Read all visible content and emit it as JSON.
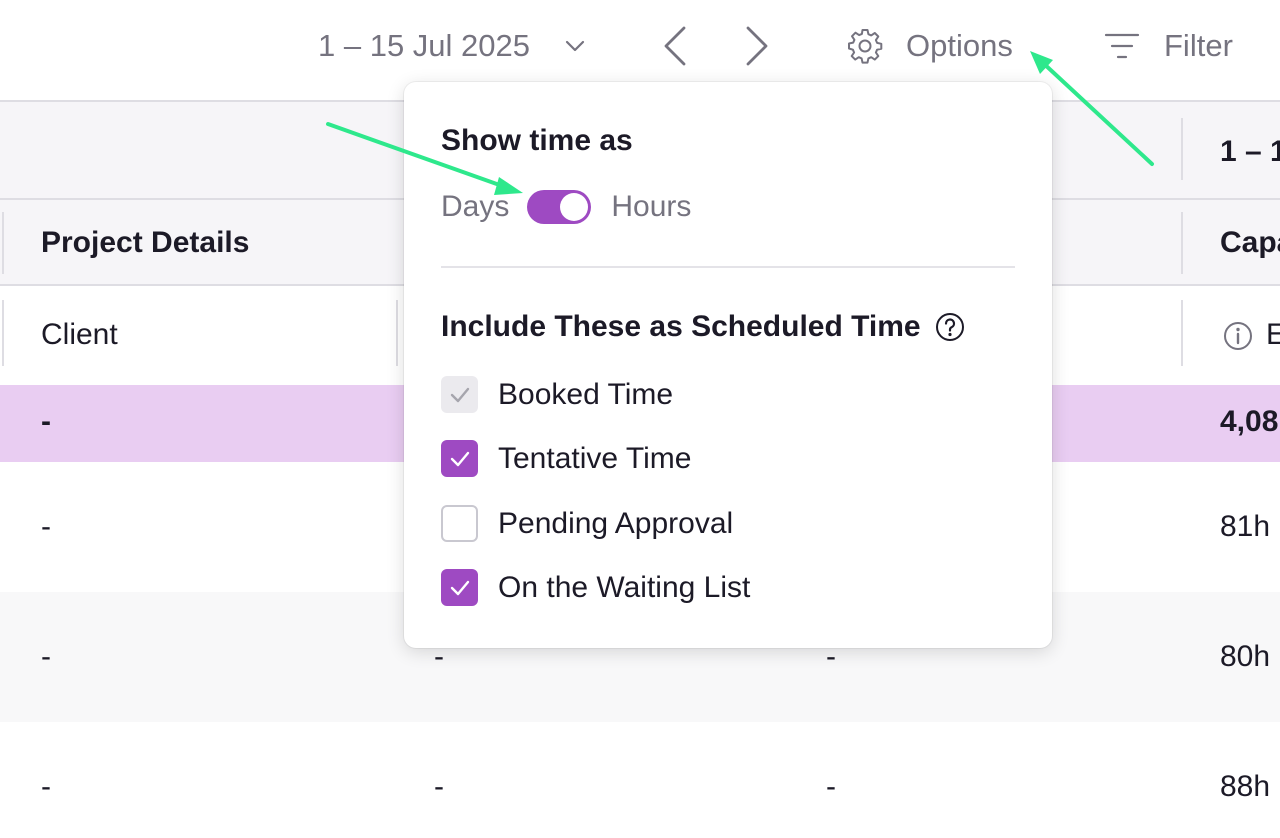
{
  "toolbar": {
    "date_range": "1 – 15 Jul 2025",
    "options_label": "Options",
    "filter_label": "Filter"
  },
  "table": {
    "period_header_partial": "1 – 1",
    "group_header": "Project Details",
    "capacity_header_partial": "Capa",
    "client_column": "Client",
    "info_partial": "E",
    "rows": [
      {
        "client": "-",
        "col2": "",
        "col3": "",
        "capacity": "4,08"
      },
      {
        "client": "-",
        "col2": "",
        "col3": "",
        "capacity": "81h"
      },
      {
        "client": "-",
        "col2": "-",
        "col3": "-",
        "capacity": "80h"
      },
      {
        "client": "-",
        "col2": "-",
        "col3": "-",
        "capacity": "88h"
      }
    ]
  },
  "options_popover": {
    "show_time_title": "Show time as",
    "toggle_left": "Days",
    "toggle_right": "Hours",
    "toggle_selected": "Hours",
    "scheduled_title": "Include These as Scheduled Time",
    "checkboxes": [
      {
        "label": "Booked Time",
        "state": "checked-disabled"
      },
      {
        "label": "Tentative Time",
        "state": "checked"
      },
      {
        "label": "Pending Approval",
        "state": "unchecked"
      },
      {
        "label": "On the Waiting List",
        "state": "checked"
      }
    ]
  },
  "colors": {
    "accent_purple": "#9e4ac2",
    "highlight_row": "#e9cdf2",
    "annotation_arrow": "#2ee88c"
  }
}
